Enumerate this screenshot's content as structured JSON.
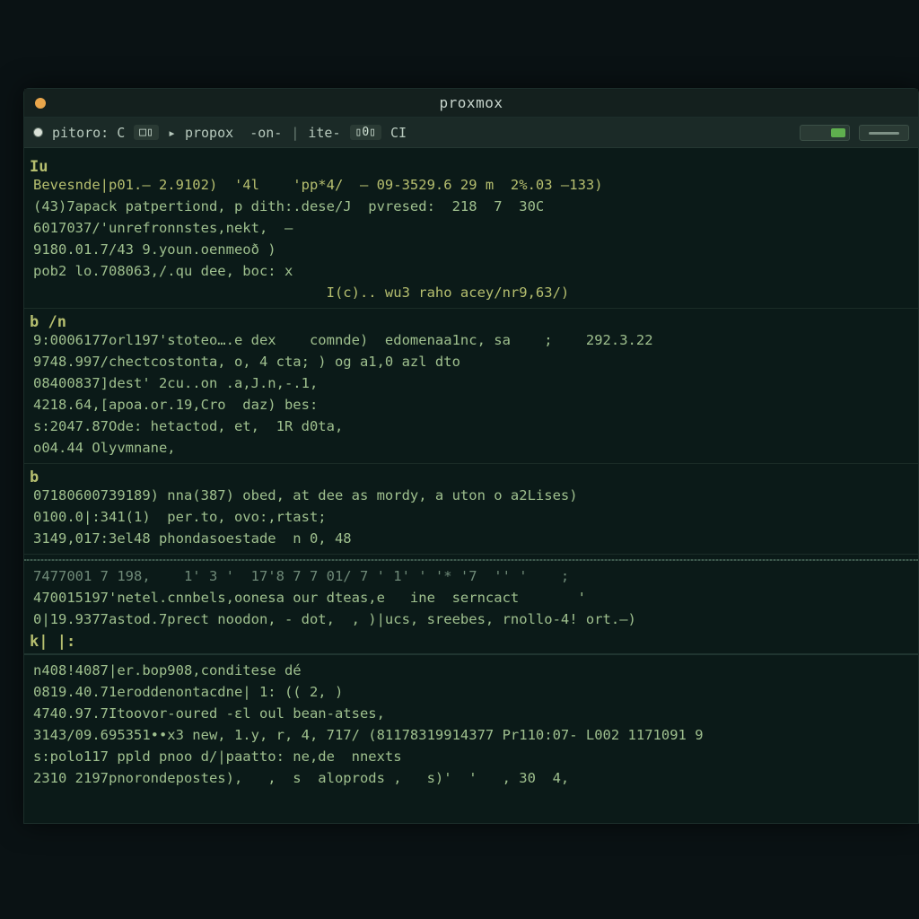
{
  "window": {
    "title": "proxmox"
  },
  "toolbar": {
    "prompt_left": "pitoro: C",
    "badge1": "□▯",
    "arrow": "▸",
    "cmd": "propox  -on-",
    "pipe": "|",
    "flag": "ite-",
    "badge2": "▯0▯",
    "tail": "CI"
  },
  "blocks": [
    {
      "marker": "Iu",
      "lines": [
        {
          "g": "",
          "t": "Bevesnde|p01.— 2.9102)  '4l    'pp*4/  – 09-3529.6 29 m  2%.03 —133)",
          "cls": "olive"
        },
        {
          "g": "",
          "t": "(43)7apack patpertiond, p dith:.dese/J  pvresed:  218  7  30C",
          "cls": ""
        },
        {
          "g": "",
          "t": "6017037/'unrefronnstes,nekt,  –",
          "cls": ""
        },
        {
          "g": "",
          "t": "9180.01.7/43 9.youn.oenmeoð )",
          "cls": ""
        },
        {
          "g": "",
          "t": "pob2 lo.708063,/.qu dee, boc: x",
          "cls": ""
        },
        {
          "g": "",
          "t": "                                   I(c).. wu3 raho acey/nr9,63/)",
          "cls": "olive"
        }
      ]
    },
    {
      "marker": "b  /n",
      "lines": [
        {
          "g": "",
          "t": "9:0006177orl197'stoteo….e dex    comnde)  edomenaa1nc, sa    ;    292.3.22",
          "cls": ""
        },
        {
          "g": "",
          "t": "9748.997/chectcostonta, o, 4 cta; ) og a1,0 azl dto",
          "cls": ""
        },
        {
          "g": "",
          "t": "08400837]dest' 2cu..on .a,J.n,-.1,",
          "cls": ""
        },
        {
          "g": "",
          "t": "4218.64,[apoa.or.19,Cro  daz) bes:",
          "cls": ""
        },
        {
          "g": "",
          "t": "s:2047.87Ode: hetactod, et,  1R d0ta,",
          "cls": ""
        },
        {
          "g": "",
          "t": "o04.44 Olyvmnane,",
          "cls": ""
        }
      ]
    },
    {
      "marker": "b",
      "lines": [
        {
          "g": "",
          "t": "07180600739189) nna(387) obed, at dee as mordy, a uton o a2Lises)",
          "cls": ""
        },
        {
          "g": "",
          "t": "0100.0|:341(1)  per.to, ovo:,rtast;",
          "cls": ""
        },
        {
          "g": "",
          "t": "3149,017:3el48 phondasoestade  n 0, 48",
          "cls": ""
        }
      ]
    },
    {
      "sepStyle": "dotted",
      "lines": [
        {
          "g": "",
          "t": "7477001 7 198,    1' 3 '  17'8 7 7 01/ 7 ' 1' ' '* '7  '' '    ;",
          "cls": "dim"
        },
        {
          "g": "",
          "t": "470015197'netel.cnnbels,oonesa our dteas,e   ine  serncact       '",
          "cls": ""
        },
        {
          "g": "",
          "t": "0|19.9377astod.7prect noodon, - dot,  , )|ucs, sreebes, rnollo-4! ort.—)",
          "cls": ""
        }
      ]
    },
    {
      "marker": "k| |:",
      "sep": true,
      "lines": [
        {
          "g": "",
          "t": "n408!4087|er.bop908,conditese dé",
          "cls": ""
        },
        {
          "g": "",
          "t": "0819.40.71eroddenontacdne| 1: (( 2, )",
          "cls": ""
        },
        {
          "g": "",
          "t": "4740.97.7Itoovor-oured -ɛl oul bean-atses,",
          "cls": ""
        },
        {
          "g": "",
          "t": "3143/09.695351••x3 new, 1.y, r, 4, 717/ (81178319914377 Pr110:07- L002 1171091 9",
          "cls": ""
        },
        {
          "g": "",
          "t": "s:polo117 ppld pnoo d/|paatto: ne,de  nnexts",
          "cls": ""
        },
        {
          "g": "",
          "t": "2310 2197pnorondepostes),   ,  s  aloprods ,   s)'  '   , 30  4,",
          "cls": ""
        }
      ]
    }
  ]
}
